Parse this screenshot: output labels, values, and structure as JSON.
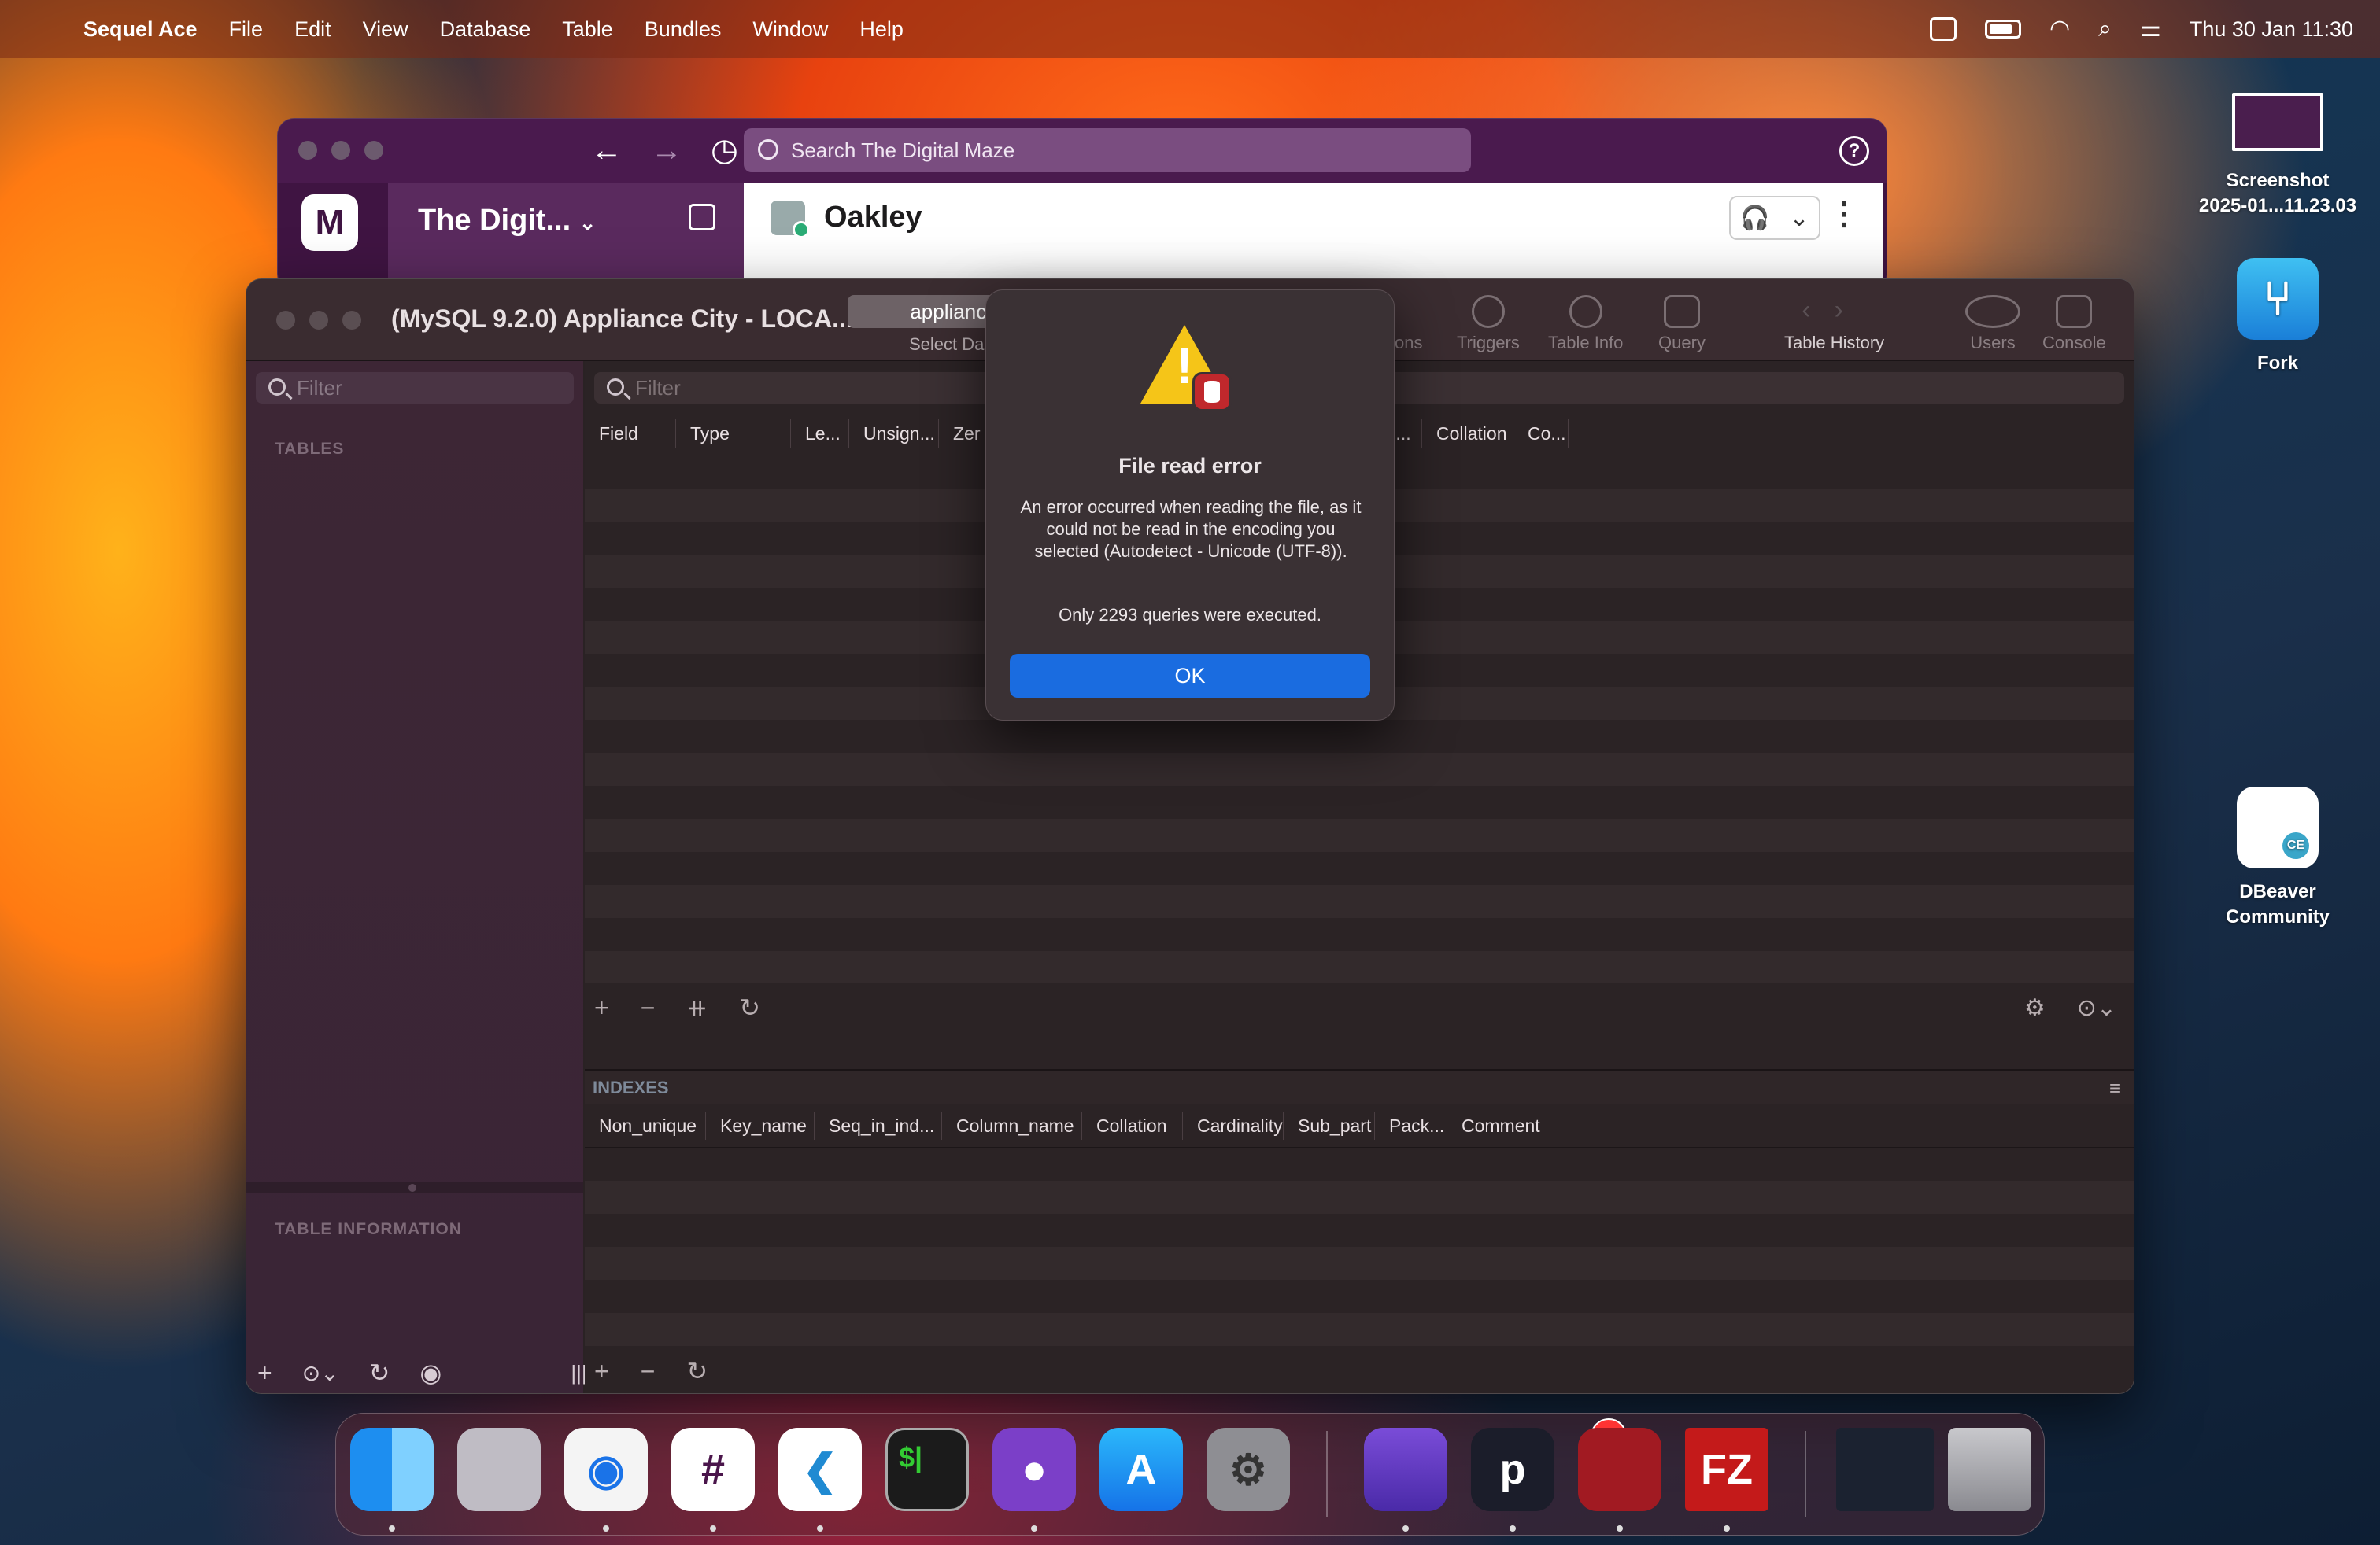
{
  "menubar": {
    "app_name": "Sequel Ace",
    "items": [
      "File",
      "Edit",
      "View",
      "Database",
      "Table",
      "Bundles",
      "Window",
      "Help"
    ],
    "clock": "Thu 30 Jan  11:30"
  },
  "slack": {
    "search_placeholder": "Search The Digital Maze",
    "workspace_name": "The Digit...",
    "workspace_initial": "M",
    "channel_name": "Oakley"
  },
  "sequel_ace": {
    "window_title": "(MySQL 9.2.0) Appliance City - LOCA...",
    "database_selector": "appliance",
    "database_selector_label": "Select Da",
    "toolbar": {
      "relations": "tions",
      "triggers": "Triggers",
      "table_info": "Table Info",
      "query": "Query",
      "table_history": "Table History",
      "users": "Users",
      "console": "Console"
    },
    "sidebar": {
      "filter_placeholder": "Filter",
      "tables_header": "TABLES",
      "table_info_header": "TABLE INFORMATION"
    },
    "structure": {
      "filter_placeholder": "Filter",
      "columns": [
        "Field",
        "Type",
        "Le...",
        "Unsign...",
        "Zer",
        "Enco...",
        "Collation",
        "Co..."
      ]
    },
    "indexes": {
      "header": "INDEXES",
      "columns": [
        "Non_unique",
        "Key_name",
        "Seq_in_ind...",
        "Column_name",
        "Collation",
        "Cardinality",
        "Sub_part",
        "Pack...",
        "Comment"
      ]
    }
  },
  "dialog": {
    "title": "File read error",
    "message": "An error occurred when reading the file, as it could not be read in the encoding you selected (Autodetect - Unicode (UTF-8)).",
    "queries_note": "Only 2293 queries were executed.",
    "ok_label": "OK"
  },
  "desktop": {
    "screenshot_label_1": "Screenshot",
    "screenshot_label_2": "2025-01...11.23.03",
    "fork_label": "Fork",
    "dbeaver_label_1": "DBeaver",
    "dbeaver_label_2": "Community"
  },
  "dock": {
    "badge_count": "1"
  },
  "colors": {
    "accent_blue": "#1a6ce0",
    "warning_yellow": "#f5c518",
    "slack_purple": "#3f1442"
  }
}
